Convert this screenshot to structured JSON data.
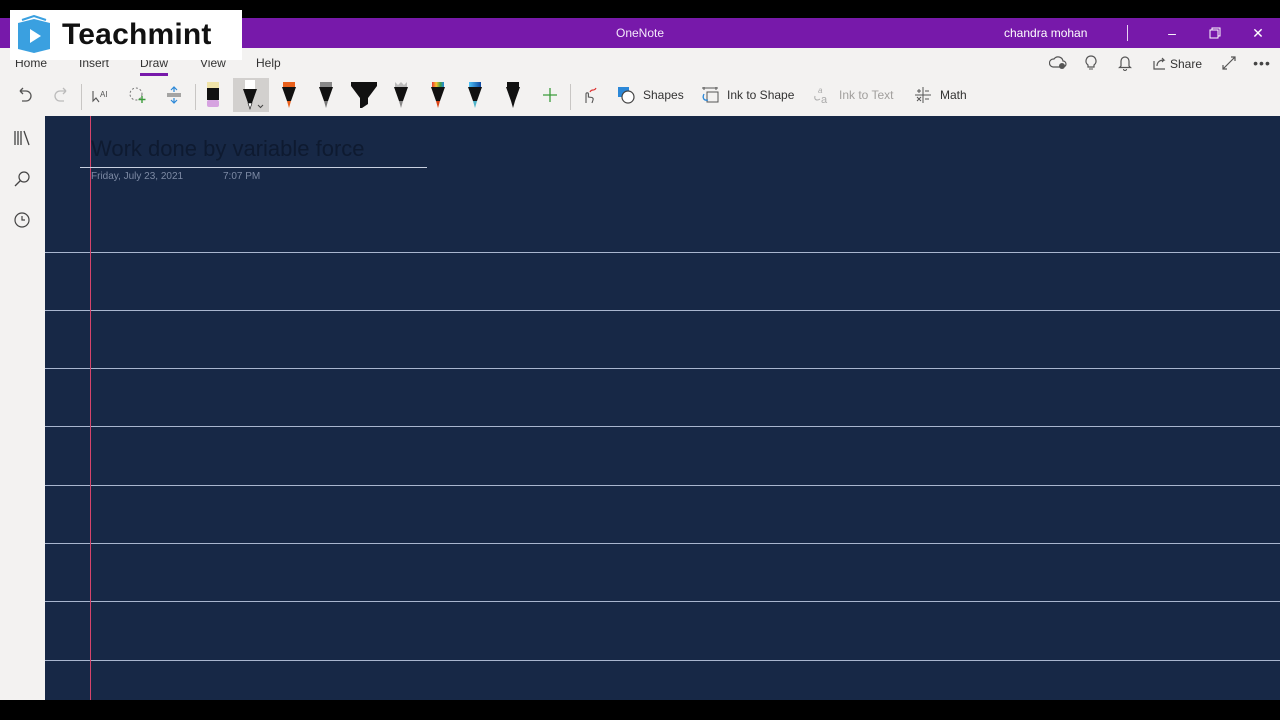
{
  "overlay": {
    "brand": "Teachmint"
  },
  "window": {
    "app_title": "OneNote",
    "user_name": "chandra mohan",
    "controls": [
      "minimize",
      "restore",
      "close"
    ]
  },
  "ribbon": {
    "tabs": [
      {
        "label": "Home"
      },
      {
        "label": "Insert"
      },
      {
        "label": "Draw",
        "active": true
      },
      {
        "label": "View"
      },
      {
        "label": "Help"
      }
    ],
    "right": {
      "share_label": "Share"
    },
    "tools": {
      "shapes_label": "Shapes",
      "ink_to_shape_label": "Ink to Shape",
      "ink_to_text_label": "Ink to Text",
      "math_label": "Math"
    },
    "accent_color": "#7719aa"
  },
  "page": {
    "title": "Work done by variable force",
    "date": "Friday, July 23, 2021",
    "time": "7:07 PM",
    "background_color": "#172846"
  }
}
